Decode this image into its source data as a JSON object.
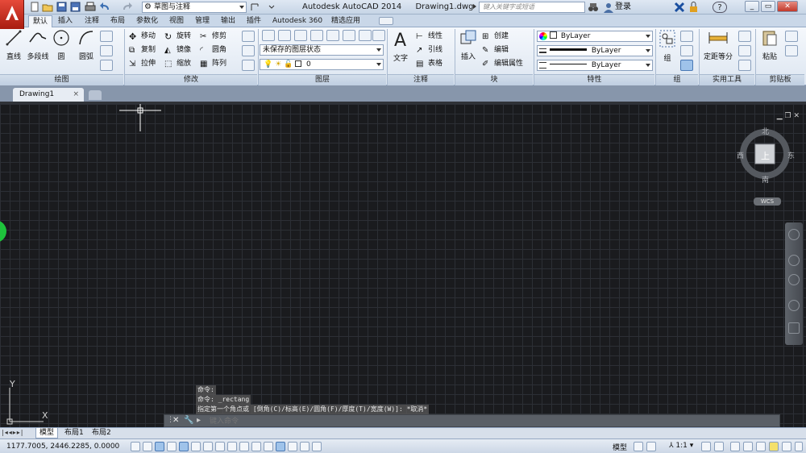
{
  "window": {
    "app_title": "Autodesk AutoCAD 2014",
    "file_name": "Drawing1.dwg",
    "workspace": "草图与注释",
    "search_placeholder": "键入关键字或短语",
    "login": "登录",
    "help": "?"
  },
  "ribbon_tabs": [
    "默认",
    "插入",
    "注释",
    "布局",
    "参数化",
    "视图",
    "管理",
    "输出",
    "插件",
    "Autodesk 360",
    "精选应用"
  ],
  "draw_panel": {
    "title": "绘图",
    "line": "直线",
    "polyline": "多段线",
    "circle": "圆",
    "arc": "圆弧"
  },
  "modify_panel": {
    "title": "修改",
    "move": "移动",
    "rotate": "旋转",
    "trim": "修剪",
    "copy": "复制",
    "mirror": "镜像",
    "fillet": "圆角",
    "stretch": "拉伸",
    "scale": "缩放",
    "array": "阵列"
  },
  "layers_panel": {
    "title": "图层",
    "layer_state": "未保存的图层状态",
    "current_layer": "0"
  },
  "annotation_panel": {
    "title": "注释",
    "text": "文字",
    "linear": "线性",
    "leader": "引线",
    "table": "表格"
  },
  "block_panel": {
    "title": "块",
    "insert": "插入",
    "create": "创建",
    "edit": "编辑",
    "edit_attributes": "编辑属性"
  },
  "properties_panel": {
    "title": "特性",
    "color": "ByLayer",
    "lineweight": "ByLayer",
    "linetype": "ByLayer"
  },
  "groups_panel": {
    "title": "组",
    "group": "组"
  },
  "utilities_panel": {
    "title": "实用工具",
    "measure": "定距等分"
  },
  "clipboard_panel": {
    "title": "剪贴板",
    "paste": "粘贴"
  },
  "doc_tab": {
    "name": "Drawing1",
    "close": "×"
  },
  "viewcube": {
    "north": "北",
    "south": "南",
    "east": "东",
    "west": "西",
    "top": "上",
    "wcs": "WCS"
  },
  "ucs": {
    "x": "X",
    "y": "Y"
  },
  "command": {
    "history": [
      "命令:",
      "命令: _rectang",
      "指定第一个角点或 [倒角(C)/标高(E)/圆角(F)/厚度(T)/宽度(W)]: *取消*"
    ],
    "placeholder": "键入命令"
  },
  "layout_tabs": [
    "模型",
    "布局1",
    "布局2"
  ],
  "statusbar": {
    "coords": "1177.7005, 2446.2285, 0.0000",
    "model": "模型",
    "scale": "1:1"
  },
  "colors": {
    "app_button": "#c82a1b",
    "canvas": "#1a1b1e",
    "grid": "#2c2f35",
    "crosshair": "#ffffff"
  }
}
